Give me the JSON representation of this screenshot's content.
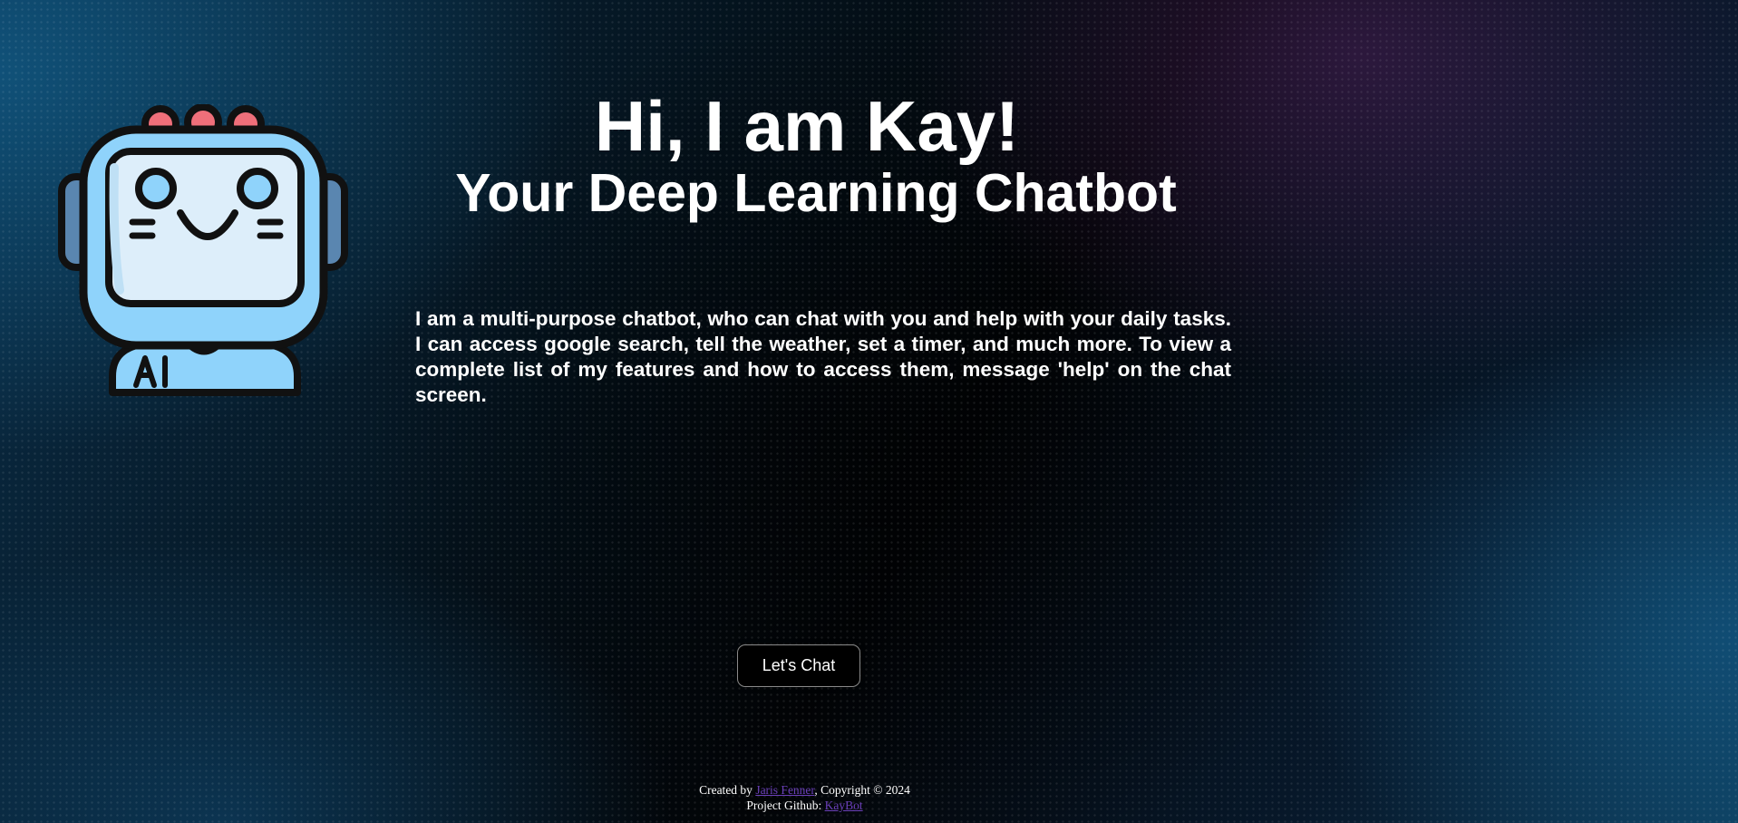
{
  "hero": {
    "title": "Hi, I am Kay!",
    "subtitle": "Your Deep Learning Chatbot",
    "description": "I am a multi-purpose chatbot, who can chat with you and help with your daily tasks. I can access google search, tell the weather, set a timer, and much more. To view a complete list of my features and how to access them, message 'help' on the chat screen."
  },
  "robot": {
    "icon": "robot-icon",
    "badge_text": "AI",
    "colors": {
      "body": "#8fd3fb",
      "screen": "#ddeefa",
      "antenna": "#ef6f7a",
      "outline": "#111111",
      "ears": "#5a86b0"
    }
  },
  "cta": {
    "label": "Let's Chat"
  },
  "footer": {
    "created_prefix": "Created by ",
    "author": "Jaris Fenner",
    "copyright": ", Copyright © 2024",
    "github_prefix": "Project Github: ",
    "github_link": "KayBot",
    "link_color": "#6a3fb8"
  }
}
